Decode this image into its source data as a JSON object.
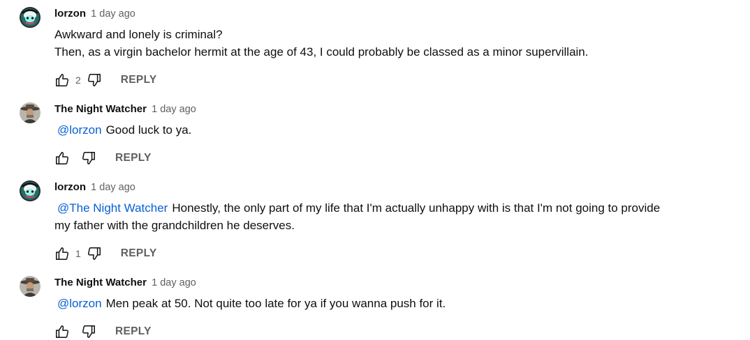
{
  "colors": {
    "link": "#065fd4",
    "secondary": "#606060",
    "text": "#0f0f0f"
  },
  "comments": [
    {
      "author": "lorzon",
      "time": "1 day ago",
      "mention": "",
      "lines": [
        "Awkward and lonely is criminal?",
        "Then, as a virgin bachelor hermit at the age of 43, I could probably be classed as a minor supervillain."
      ],
      "likes": "2",
      "reply_label": "REPLY",
      "avatar": "lorzon-avatar"
    },
    {
      "author": "The Night Watcher",
      "time": "1 day ago",
      "mention": "@lorzon",
      "lines": [
        "Good luck to ya."
      ],
      "likes": "",
      "reply_label": "REPLY",
      "avatar": "night-watcher-avatar"
    },
    {
      "author": "lorzon",
      "time": "1 day ago",
      "mention": "@The Night Watcher",
      "lines": [
        "Honestly, the only part of my life that I'm actually unhappy with is that I'm not going to provide",
        "my father with the grandchildren he deserves."
      ],
      "likes": "1",
      "reply_label": "REPLY",
      "avatar": "lorzon-avatar"
    },
    {
      "author": "The Night Watcher",
      "time": "1 day ago",
      "mention": "@lorzon",
      "lines": [
        "Men peak at 50. Not quite too late for ya if you wanna push for it."
      ],
      "likes": "",
      "reply_label": "REPLY",
      "avatar": "night-watcher-avatar"
    }
  ]
}
